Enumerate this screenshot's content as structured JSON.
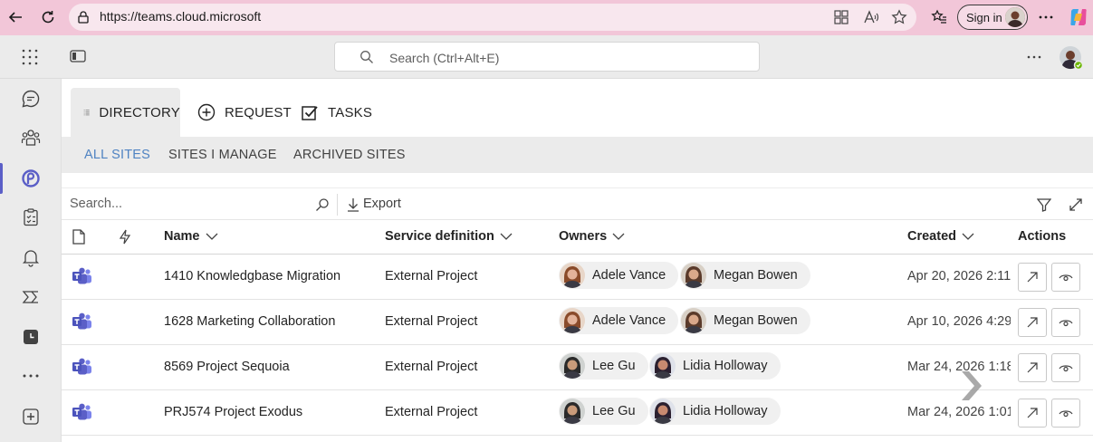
{
  "browser": {
    "url": "https://teams.cloud.microsoft",
    "sign_in_label": "Sign in"
  },
  "app": {
    "search_placeholder": "Search (Ctrl+Alt+E)",
    "accent_color": "#5b5fc7"
  },
  "tabs": [
    {
      "label": "DIRECTORY",
      "icon": "list-icon",
      "active": true
    },
    {
      "label": "REQUEST",
      "icon": "plus-circle-icon",
      "active": false
    },
    {
      "label": "TASKS",
      "icon": "checkbox-icon",
      "active": false
    }
  ],
  "subtabs": [
    {
      "label": "ALL SITES",
      "active": true
    },
    {
      "label": "SITES I MANAGE",
      "active": false
    },
    {
      "label": "ARCHIVED SITES",
      "active": false
    }
  ],
  "toolbar": {
    "search_placeholder": "Search...",
    "export_label": "Export"
  },
  "table": {
    "columns": {
      "name": "Name",
      "service": "Service definition",
      "owners": "Owners",
      "created": "Created",
      "actions": "Actions"
    },
    "rows": [
      {
        "name": "1410 Knowledgbase Migration",
        "service": "External Project",
        "owner1": "Adele Vance",
        "owner2": "Megan Bowen",
        "created": "Apr 20, 2026 2:11"
      },
      {
        "name": "1628 Marketing Collaboration",
        "service": "External Project",
        "owner1": "Adele Vance",
        "owner2": "Megan Bowen",
        "created": "Apr 10, 2026 4:29"
      },
      {
        "name": "8569 Project Sequoia",
        "service": "External Project",
        "owner1": "Lee Gu",
        "owner2": "Lidia Holloway",
        "created": "Mar 24, 2026 1:18"
      },
      {
        "name": "PRJ574 Project Exodus",
        "service": "External Project",
        "owner1": "Lee Gu",
        "owner2": "Lidia Holloway",
        "created": "Mar 24, 2026 1:01"
      }
    ]
  }
}
